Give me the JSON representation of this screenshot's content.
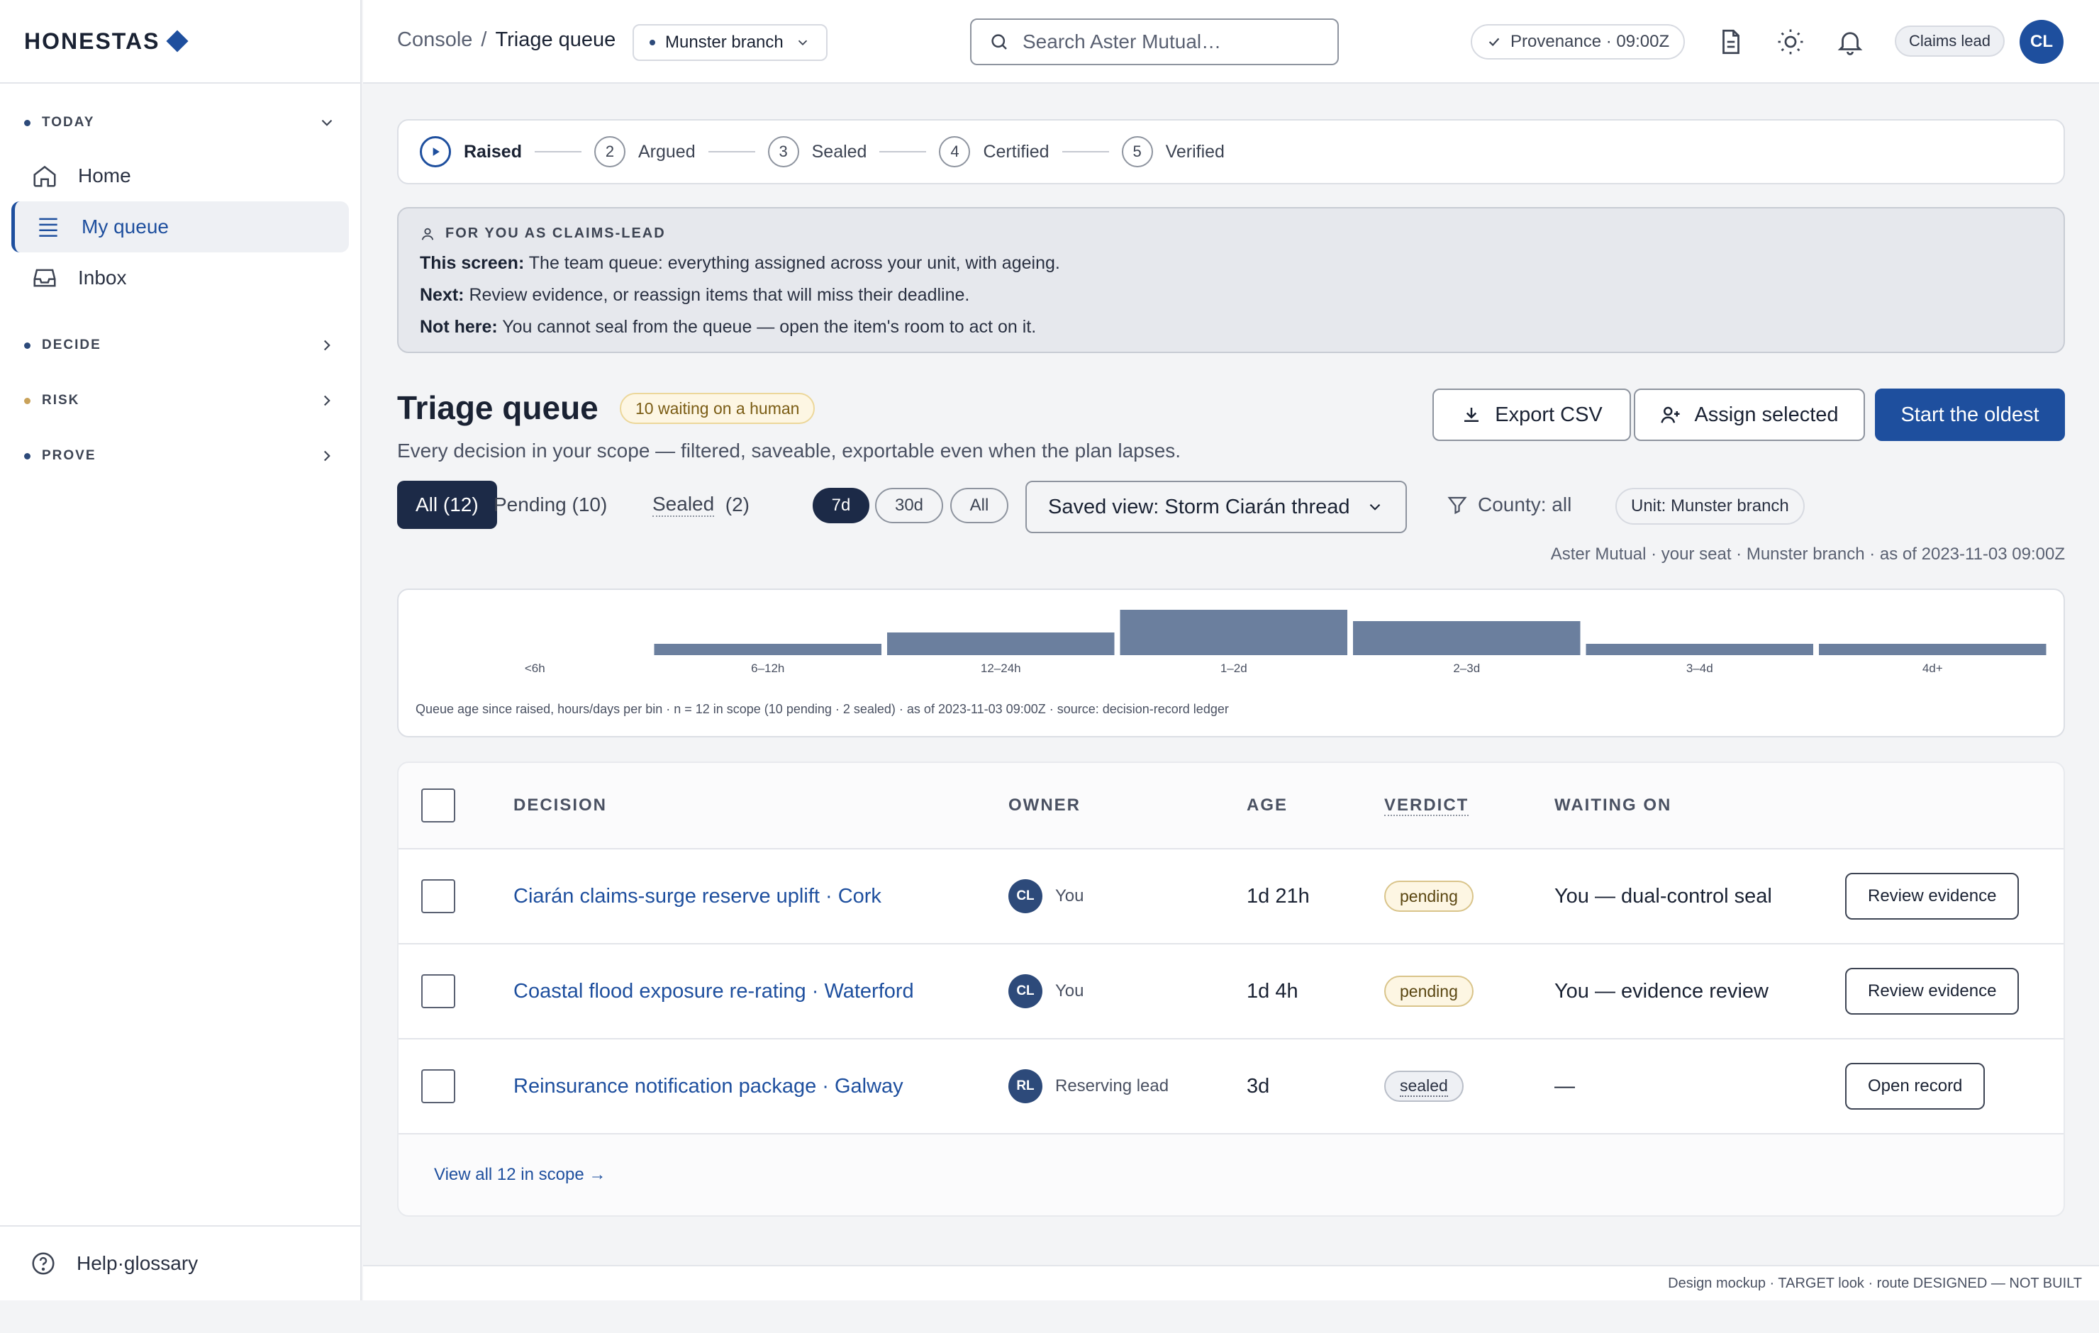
{
  "brand": {
    "name": "HONESTAS"
  },
  "sidebar": {
    "sections": [
      {
        "label": "TODAY",
        "color": "#2d4a7a",
        "expanded": true
      },
      {
        "label": "DECIDE",
        "color": "#2d4a7a",
        "expanded": false
      },
      {
        "label": "RISK",
        "color": "#c9a25a",
        "expanded": false
      },
      {
        "label": "PROVE",
        "color": "#2d4a7a",
        "expanded": false
      }
    ],
    "items": [
      {
        "label": "Home",
        "icon": "home-icon"
      },
      {
        "label": "My queue",
        "icon": "list-icon",
        "active": true
      },
      {
        "label": "Inbox",
        "icon": "inbox-icon"
      }
    ],
    "footer": {
      "label": "Help·glossary",
      "icon": "help-icon"
    }
  },
  "topbar": {
    "breadcrumb": {
      "root": "Console",
      "separator": "/",
      "current": "Triage queue"
    },
    "branch": "Munster branch",
    "search": {
      "placeholder": "Search Aster Mutual…",
      "value": ""
    },
    "provenance": "Provenance · 09:00Z",
    "icons": [
      "document-icon",
      "sun-icon",
      "bell-icon"
    ],
    "role": "Claims lead",
    "avatar_initials": "CL"
  },
  "stepper": {
    "steps": [
      {
        "num": "",
        "label": "Raised",
        "current": true
      },
      {
        "num": "2",
        "label": "Argued"
      },
      {
        "num": "3",
        "label": "Sealed"
      },
      {
        "num": "4",
        "label": "Certified"
      },
      {
        "num": "5",
        "label": "Verified"
      }
    ]
  },
  "notice": {
    "heading": "FOR YOU AS CLAIMS-LEAD",
    "lines": [
      {
        "label": "This screen:",
        "text": "The team queue: everything assigned across your unit, with ageing."
      },
      {
        "label": "Next:",
        "text": "Review evidence, or reassign items that will miss their deadline."
      },
      {
        "label": "Not here:",
        "text": "You cannot seal from the queue — open the item's room to act on it."
      }
    ]
  },
  "header": {
    "title": "Triage queue",
    "badge": "10 waiting on a human",
    "subtitle": "Every decision in your scope — filtered, saveable, exportable even when the plan lapses.",
    "actions": {
      "export": "Export CSV",
      "assign": "Assign selected",
      "start": "Start the oldest"
    }
  },
  "filters": {
    "tabs": [
      {
        "label": "All (12)",
        "active": true
      },
      {
        "label": "Pending (10)"
      },
      {
        "label": "Sealed",
        "count": "(2)"
      }
    ],
    "ranges": [
      {
        "label": "7d",
        "active": true
      },
      {
        "label": "30d"
      },
      {
        "label": "All"
      }
    ],
    "saved_view": "Saved view: Storm Ciarán thread",
    "county": "County: all",
    "unit": "Unit: Munster branch"
  },
  "scope_line": "Aster Mutual · your seat · Munster branch · as of 2023-11-03 09:00Z",
  "chart_data": {
    "type": "bar",
    "categories": [
      "<6h",
      "6–12h",
      "12–24h",
      "1–2d",
      "2–3d",
      "3–4d",
      "4d+"
    ],
    "values": [
      0,
      1,
      2,
      4,
      3,
      1,
      1
    ],
    "ylim": [
      0,
      4
    ],
    "color": "#6b7f9e",
    "caption": "Queue age since raised, hours/days per bin · n = 12 in scope (10 pending · 2 sealed) · as of 2023-11-03 09:00Z · source: decision-record ledger"
  },
  "table": {
    "headers": {
      "decision": "DECISION",
      "owner": "OWNER",
      "age": "AGE",
      "verdict": "VERDICT",
      "waiting": "WAITING ON"
    },
    "rows": [
      {
        "decision": "Ciarán claims-surge reserve uplift · Cork",
        "owner_initials": "CL",
        "owner": "You",
        "age": "1d 21h",
        "verdict": "pending",
        "waiting": "You — dual-control seal",
        "action": "Review evidence"
      },
      {
        "decision": "Coastal flood exposure re-rating · Waterford",
        "owner_initials": "CL",
        "owner": "You",
        "age": "1d 4h",
        "verdict": "pending",
        "waiting": "You — evidence review",
        "action": "Review evidence"
      },
      {
        "decision": "Reinsurance notification package · Galway",
        "owner_initials": "RL",
        "owner": "Reserving lead",
        "age": "3d",
        "verdict": "sealed",
        "waiting": "—",
        "action": "Open record"
      }
    ],
    "footer_link": "View all 12 in scope →"
  },
  "page_footer": "Design mockup · TARGET look · route DESIGNED — NOT BUILT"
}
